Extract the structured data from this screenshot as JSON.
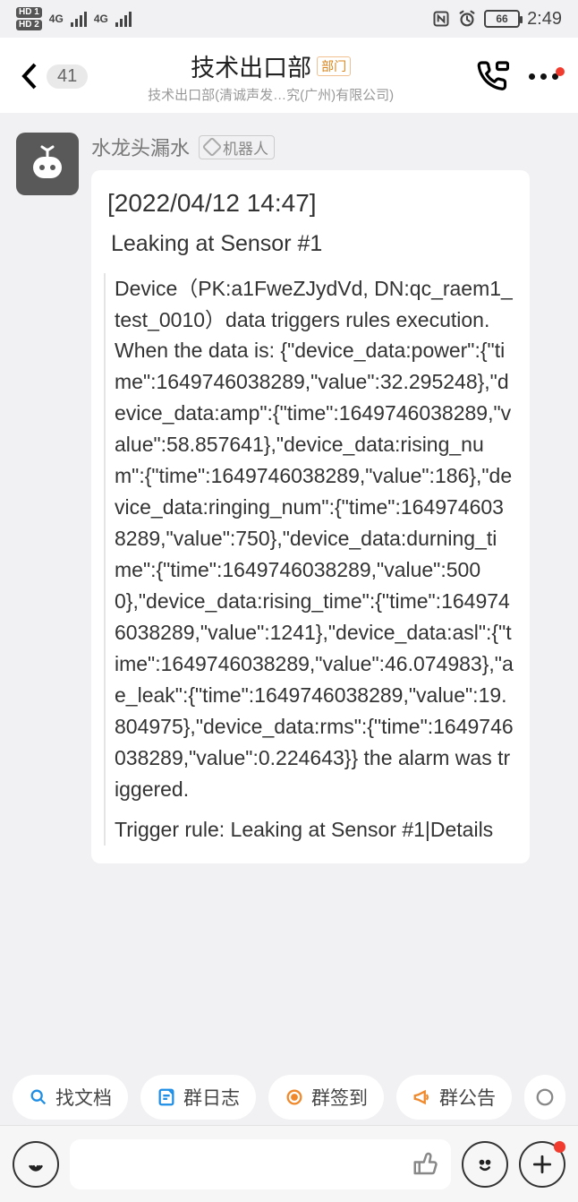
{
  "status": {
    "hd1": "HD 1",
    "hd2": "HD 2",
    "net1": "4G",
    "net2": "4G",
    "nfc_icon": "nfc",
    "alarm_icon": "alarm",
    "battery_pct": "66",
    "clock": "2:49"
  },
  "header": {
    "back_count": "41",
    "title": "技术出口部",
    "dept_tag": "部门",
    "subtitle": "技术出口部(清诚声发…究(广州)有限公司)"
  },
  "message": {
    "sender_name": "水龙头漏水",
    "bot_tag": "机器人",
    "timestamp": "[2022/04/12 14:47]",
    "alert_title": "Leaking at Sensor #1",
    "device_intro": "Device（PK:a1FweZJydVd, DN:qc_raem1_test_0010）data triggers rules execution. When the data is: {\"device_data:power\":{\"time\":1649746038289,\"value\":32.295248},\"device_data:amp\":{\"time\":1649746038289,\"value\":58.857641},\"device_data:rising_num\":{\"time\":1649746038289,\"value\":186},\"device_data:ringing_num\":{\"time\":1649746038289,\"value\":750},\"device_data:durning_time\":{\"time\":1649746038289,\"value\":5000},\"device_data:rising_time\":{\"time\":1649746038289,\"value\":1241},\"device_data:asl\":{\"time\":1649746038289,\"value\":46.074983},\"ae_leak\":{\"time\":1649746038289,\"value\":19.804975},\"device_data:rms\":{\"time\":1649746038289,\"value\":0.224643}} the alarm was triggered.",
    "trigger_rule": "Trigger rule: Leaking at Sensor #1|Details"
  },
  "shortcuts": {
    "find_doc": "找文档",
    "group_log": "群日志",
    "group_checkin": "群签到",
    "group_notice": "群公告"
  },
  "colors": {
    "find_doc": "#1f8fe6",
    "group_log": "#1f8fe6",
    "group_checkin": "#f0892b",
    "group_notice": "#f0892b"
  }
}
